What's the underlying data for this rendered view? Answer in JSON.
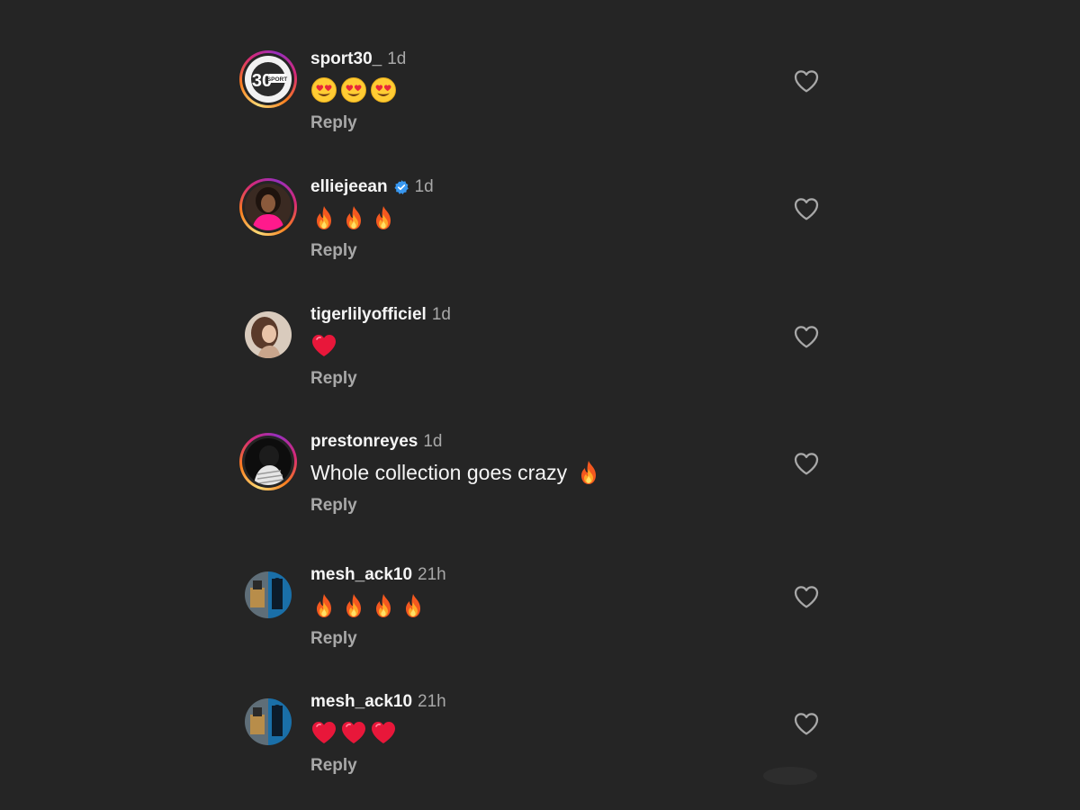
{
  "colors": {
    "background": "#252525",
    "text_primary": "#f5f5f5",
    "text_secondary": "#a8a8a8",
    "verified_blue": "#3897f0",
    "story_ring": [
      "#feda75",
      "#fa7e1e",
      "#d62976",
      "#962fbf"
    ]
  },
  "icons": {
    "like": "heart-outline-icon",
    "verified": "verified-badge-icon",
    "emoji_heart_eyes": "heart-eyes-emoji",
    "emoji_fire": "fire-emoji",
    "emoji_red_heart": "red-heart-emoji"
  },
  "comments": [
    {
      "username": "sport30_",
      "time": "1d",
      "verified": false,
      "story_ring": true,
      "avatar_logo_number": "30",
      "avatar_logo_text": "SPORT",
      "emoji_text": "😍😍😍",
      "reply_label": "Reply"
    },
    {
      "username": "elliejeean",
      "time": "1d",
      "verified": true,
      "story_ring": true,
      "emoji_text": "🔥🔥🔥",
      "reply_label": "Reply"
    },
    {
      "username": "tigerlilyofficiel",
      "time": "1d",
      "verified": false,
      "story_ring": false,
      "emoji_text": "❤️",
      "reply_label": "Reply"
    },
    {
      "username": "prestonreyes",
      "time": "1d",
      "verified": false,
      "story_ring": true,
      "text": "Whole collection goes crazy",
      "emoji_text": "🔥",
      "reply_label": "Reply"
    },
    {
      "username": "mesh_ack10",
      "time": "21h",
      "verified": false,
      "story_ring": false,
      "emoji_text": "🔥🔥🔥🔥",
      "reply_label": "Reply"
    },
    {
      "username": "mesh_ack10",
      "time": "21h",
      "verified": false,
      "story_ring": false,
      "emoji_text": "❤️❤️❤️",
      "reply_label": "Reply"
    }
  ]
}
